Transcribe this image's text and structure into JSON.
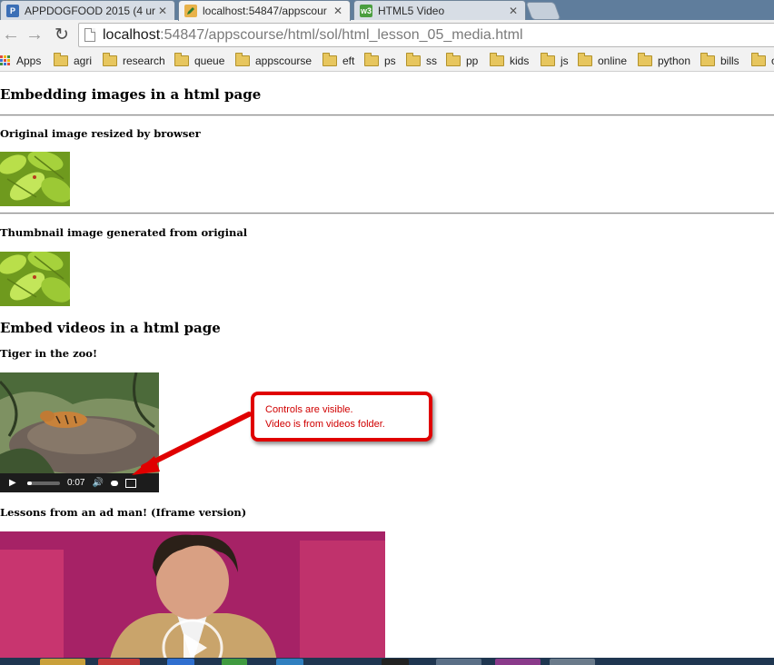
{
  "tabs": [
    {
      "title": "APPDOGFOOD 2015 (4 ur",
      "favicon": "p-icon",
      "active": false
    },
    {
      "title": "localhost:54847/appscour",
      "favicon": "pencil-icon",
      "active": true
    },
    {
      "title": "HTML5 Video",
      "favicon": "w3-icon",
      "active": false
    }
  ],
  "tab_favicon_text": {
    "p": "P",
    "w3": "w3"
  },
  "url": {
    "host": "localhost",
    "rest": ":54847/appscourse/html/sol/html_lesson_05_media.html"
  },
  "bookmarks": {
    "apps_label": "Apps",
    "folders": [
      "agri",
      "research",
      "queue",
      "appscourse",
      "eft",
      "ps",
      "ss",
      "pp",
      "kids",
      "js",
      "online",
      "python",
      "bills",
      "o"
    ]
  },
  "page": {
    "heading_images": "Embedding images in a html page",
    "label_original": "Original image resized by browser",
    "label_thumbnail": "Thumbnail image generated from original",
    "heading_videos": "Embed videos in a html page",
    "label_tiger": "Tiger in the zoo!",
    "label_adman": "Lessons from an ad man! (Iframe version)",
    "video_time": "0:07",
    "video_progress": 0.15
  },
  "callout": {
    "line1": "Controls are visible.",
    "line2": "Video is from videos folder."
  },
  "colors": {
    "callout_red": "#e00000",
    "tab_strip": "#5f7d9c",
    "ted_red": "#b0296a"
  }
}
